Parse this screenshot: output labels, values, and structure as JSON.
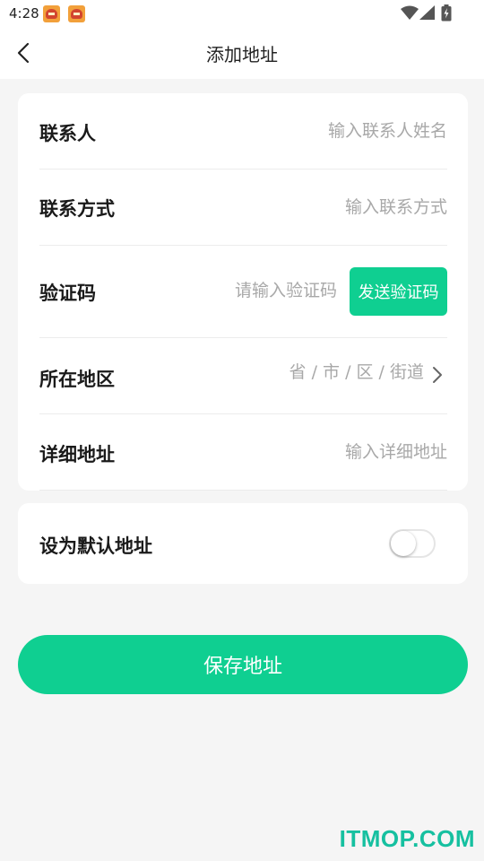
{
  "status_bar": {
    "time": "4:28"
  },
  "header": {
    "title": "添加地址"
  },
  "form": {
    "contact_label": "联系人",
    "contact_placeholder": "输入联系人姓名",
    "phone_label": "联系方式",
    "phone_placeholder": "输入联系方式",
    "code_label": "验证码",
    "code_placeholder": "请输入验证码",
    "send_code_label": "发送验证码",
    "region_label": "所在地区",
    "region_placeholder": "省 / 市 / 区 / 街道",
    "address_label": "详细地址",
    "address_placeholder": "输入详细地址"
  },
  "default_setting": {
    "label": "设为默认地址",
    "enabled": false
  },
  "save_button": {
    "label": "保存地址"
  },
  "watermark": {
    "text": "ITMOP.COM"
  },
  "colors": {
    "accent": "#0fcf91",
    "background": "#f5f5f5",
    "placeholder": "#a8a8a8",
    "watermark": "#16c0a0"
  },
  "icons": {
    "back": "chevron-left-icon",
    "region_arrow": "chevron-right-icon",
    "status": [
      "notification-icon",
      "notification-icon",
      "wifi-icon",
      "signal-icon",
      "battery-icon"
    ]
  }
}
